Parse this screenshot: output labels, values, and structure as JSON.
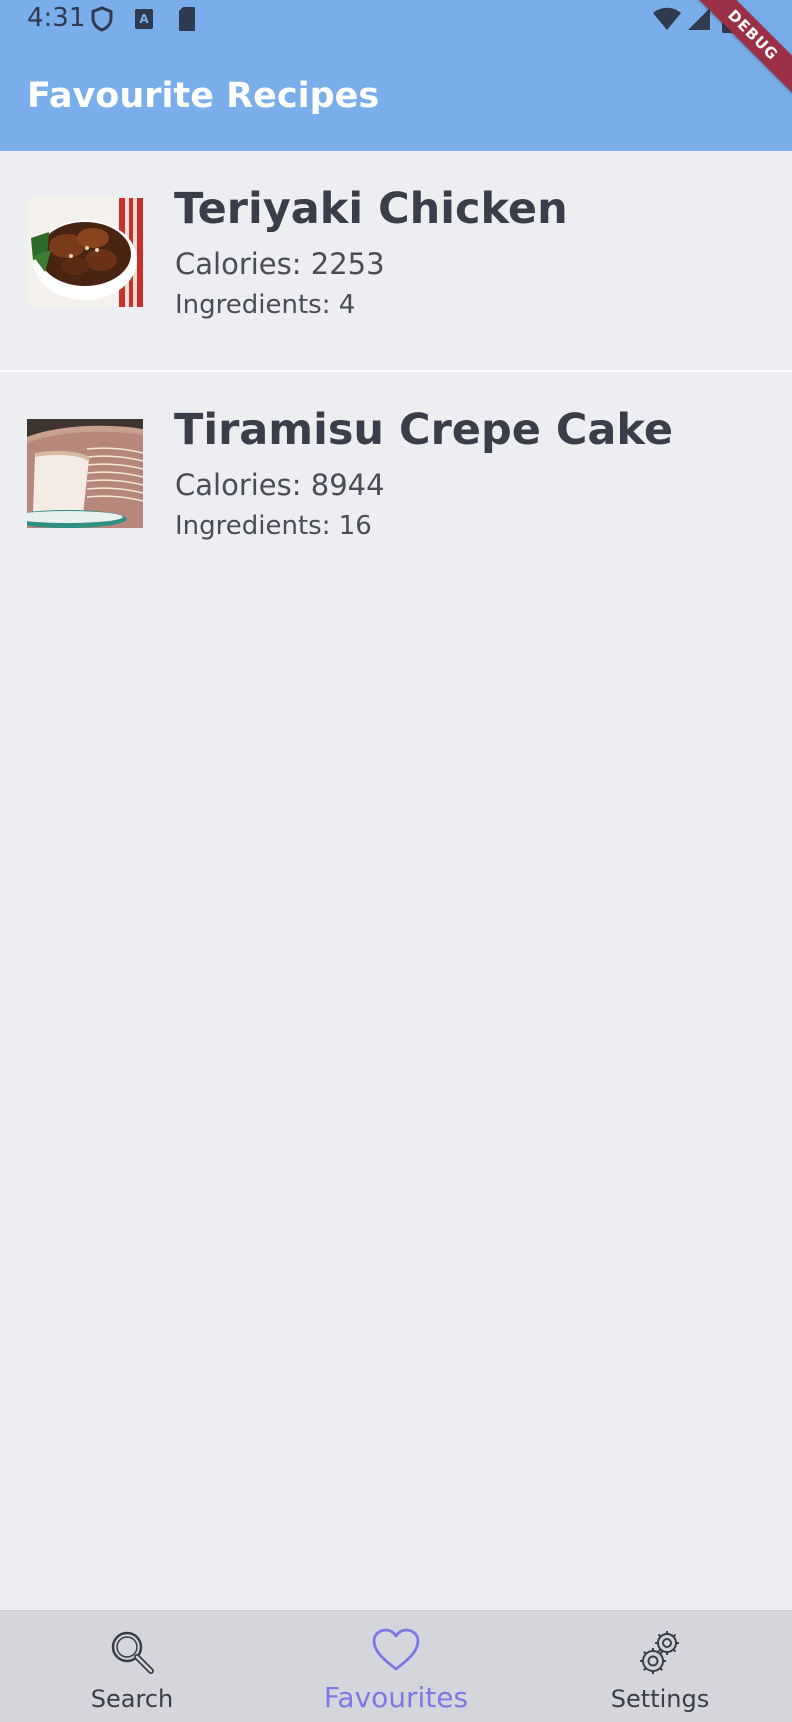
{
  "status_bar": {
    "time": "4:31",
    "icons": [
      "shield-icon",
      "a-notification-icon",
      "sd-card-icon",
      "wifi-icon",
      "signal-icon",
      "battery-icon"
    ]
  },
  "debug_banner": "DEBUG",
  "app_bar": {
    "title": "Favourite Recipes",
    "color": "#7aaeea"
  },
  "recipes": [
    {
      "title": "Teriyaki Chicken",
      "calories": "Calories: 2253",
      "ingredients": "Ingredients: 4",
      "image": "teriyaki-chicken-thumbnail"
    },
    {
      "title": "Tiramisu Crepe Cake",
      "calories": "Calories: 8944",
      "ingredients": "Ingredients: 16",
      "image": "tiramisu-crepe-cake-thumbnail"
    }
  ],
  "bottom_nav": {
    "items": [
      {
        "label": "Search",
        "icon": "search-icon",
        "selected": false
      },
      {
        "label": "Favourites",
        "icon": "heart-icon",
        "selected": true
      },
      {
        "label": "Settings",
        "icon": "gear-icon",
        "selected": false
      }
    ],
    "selected_color": "#7b79e6"
  }
}
